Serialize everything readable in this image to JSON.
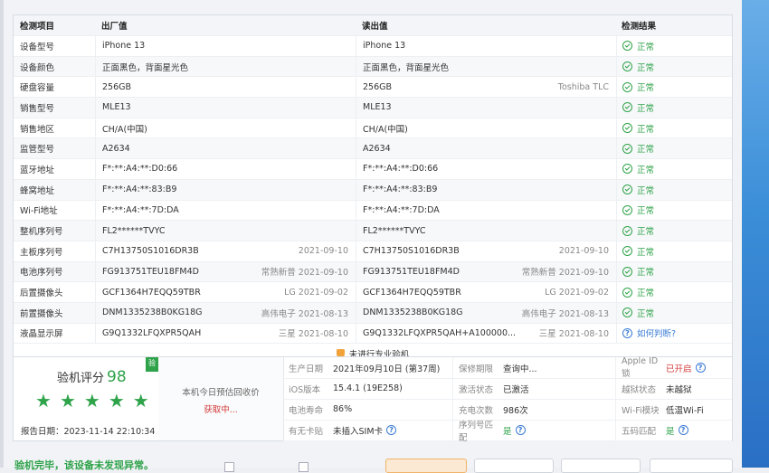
{
  "table": {
    "headers": [
      "检测项目",
      "出厂值",
      "读出值",
      "检测结果"
    ],
    "rows": [
      {
        "item": "设备型号",
        "factory": "iPhone 13",
        "factory_note": "",
        "read": "iPhone 13",
        "read_note": "",
        "result": "正常",
        "status": "ok"
      },
      {
        "item": "设备颜色",
        "factory": "正面黑色，背面星光色",
        "factory_note": "",
        "read": "正面黑色，背面星光色",
        "read_note": "",
        "result": "正常",
        "status": "ok"
      },
      {
        "item": "硬盘容量",
        "factory": "256GB",
        "factory_note": "",
        "read": "256GB",
        "read_note": "Toshiba TLC",
        "result": "正常",
        "status": "ok"
      },
      {
        "item": "销售型号",
        "factory": "MLE13",
        "factory_note": "",
        "read": "MLE13",
        "read_note": "",
        "result": "正常",
        "status": "ok"
      },
      {
        "item": "销售地区",
        "factory": "CH/A(中国)",
        "factory_note": "",
        "read": "CH/A(中国)",
        "read_note": "",
        "result": "正常",
        "status": "ok"
      },
      {
        "item": "监管型号",
        "factory": "A2634",
        "factory_note": "",
        "read": "A2634",
        "read_note": "",
        "result": "正常",
        "status": "ok"
      },
      {
        "item": "蓝牙地址",
        "factory": "F*:**:A4:**:D0:66",
        "factory_note": "",
        "read": "F*:**:A4:**:D0:66",
        "read_note": "",
        "result": "正常",
        "status": "ok"
      },
      {
        "item": "蜂窝地址",
        "factory": "F*:**:A4:**:83:B9",
        "factory_note": "",
        "read": "F*:**:A4:**:83:B9",
        "read_note": "",
        "result": "正常",
        "status": "ok"
      },
      {
        "item": "Wi-Fi地址",
        "factory": "F*:**:A4:**:7D:DA",
        "factory_note": "",
        "read": "F*:**:A4:**:7D:DA",
        "read_note": "",
        "result": "正常",
        "status": "ok"
      },
      {
        "item": "整机序列号",
        "factory": "FL2******TVYC",
        "factory_note": "",
        "read": "FL2******TVYC",
        "read_note": "",
        "result": "正常",
        "status": "ok"
      },
      {
        "item": "主板序列号",
        "factory": "C7H13750S1016DR3B",
        "factory_note": "2021-09-10",
        "read": "C7H13750S1016DR3B",
        "read_note": "2021-09-10",
        "result": "正常",
        "status": "ok"
      },
      {
        "item": "电池序列号",
        "factory": "FG913751TEU18FM4D",
        "factory_note": "常熟新普 2021-09-10",
        "read": "FG913751TEU18FM4D",
        "read_note": "常熟新普 2021-09-10",
        "result": "正常",
        "status": "ok"
      },
      {
        "item": "后置摄像头",
        "factory": "GCF1364H7EQQ59TBR",
        "factory_note": "LG 2021-09-02",
        "read": "GCF1364H7EQQ59TBR",
        "read_note": "LG 2021-09-02",
        "result": "正常",
        "status": "ok"
      },
      {
        "item": "前置摄像头",
        "factory": "DNM1335238B0KG18G",
        "factory_note": "高伟电子 2021-08-13",
        "read": "DNM1335238B0KG18G",
        "read_note": "高伟电子 2021-08-13",
        "result": "正常",
        "status": "ok"
      },
      {
        "item": "液晶显示屏",
        "factory": "G9Q1332LFQXPR5QAH",
        "factory_note": "三星 2021-08-10",
        "read": "G9Q1332LFQXPR5QAH+A100000...",
        "read_note": "三星 2021-08-10",
        "result": "如何判断?",
        "status": "help"
      }
    ],
    "pro_notice": "未进行专业验机"
  },
  "summary": {
    "score_label": "验机评分",
    "score": "98",
    "badge": "验",
    "stars": 5,
    "report_date": "报告日期：2023-11-14 22:10:34",
    "quote_label": "本机今日预估回收价",
    "quote_action": "获取中...",
    "info": [
      [
        {
          "k": "生产日期",
          "v": "2021年09月10日 (第37周)"
        },
        {
          "k": "保修期限",
          "v": "查询中..."
        },
        {
          "k": "Apple ID锁",
          "v": "已开启",
          "cls": "red",
          "help": "?"
        }
      ],
      [
        {
          "k": "iOS版本",
          "v": "15.4.1 (19E258)"
        },
        {
          "k": "激活状态",
          "v": "已激活"
        },
        {
          "k": "越狱状态",
          "v": "未越狱"
        }
      ],
      [
        {
          "k": "电池寿命",
          "v": "86%"
        },
        {
          "k": "充电次数",
          "v": "986次"
        },
        {
          "k": "Wi-Fi模块",
          "v": "低温Wi-Fi"
        }
      ],
      [
        {
          "k": "有无卡贴",
          "v": "未插入SIM卡",
          "help": "?"
        },
        {
          "k": "序列号匹配",
          "v": "是",
          "cls": "green",
          "help": "?"
        },
        {
          "k": "五码匹配",
          "v": "是",
          "cls": "green",
          "help": "?"
        }
      ]
    ]
  },
  "footer": {
    "message": "验机完毕，该设备未发现异常。"
  },
  "colors": {
    "ok": "#2fa34a",
    "warn": "#d23b3b",
    "link": "#3a7bd5"
  }
}
